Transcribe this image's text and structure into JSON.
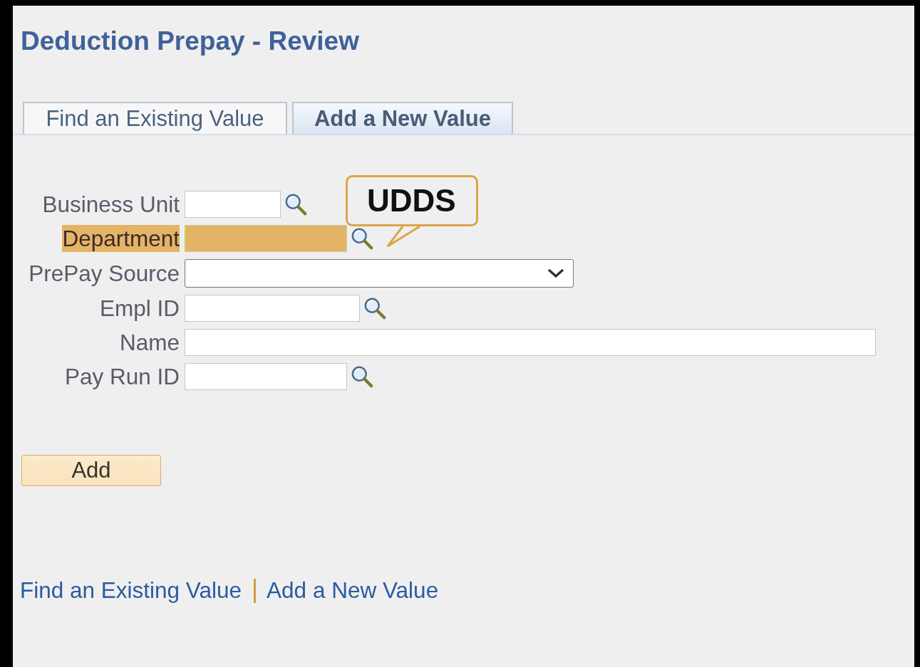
{
  "page_title": "Deduction Prepay - Review",
  "tabs": [
    {
      "label": "Find an Existing Value",
      "selected": false
    },
    {
      "label": "Add a New Value",
      "selected": true
    }
  ],
  "fields": [
    {
      "label": "Business Unit",
      "kind": "lookup",
      "highlighted": false
    },
    {
      "label": "Department",
      "kind": "lookup",
      "highlighted": true
    },
    {
      "label": "PrePay Source",
      "kind": "select",
      "highlighted": false
    },
    {
      "label": "Empl ID",
      "kind": "lookup",
      "highlighted": false
    },
    {
      "label": "Name",
      "kind": "text",
      "highlighted": false
    },
    {
      "label": "Pay Run ID",
      "kind": "lookup",
      "highlighted": false
    }
  ],
  "callout": {
    "text": "UDDS"
  },
  "add_button": "Add",
  "footer_links": [
    "Find an Existing Value",
    "Add a New Value"
  ]
}
